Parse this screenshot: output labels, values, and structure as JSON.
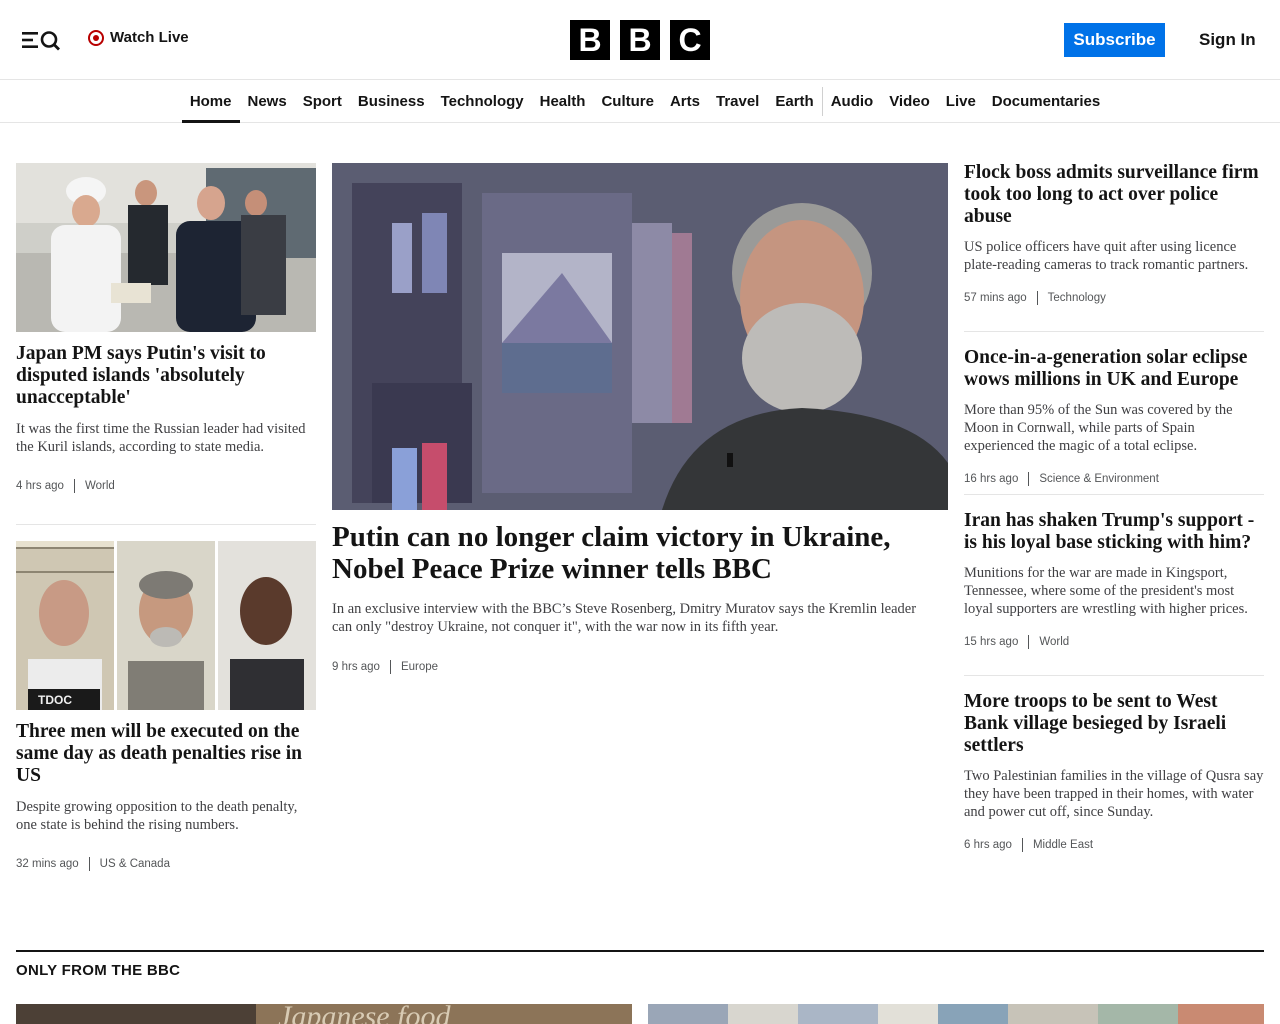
{
  "header": {
    "watch_live": "Watch Live",
    "logo_letters": [
      "B",
      "B",
      "C"
    ],
    "subscribe": "Subscribe",
    "sign_in": "Sign In"
  },
  "nav": {
    "items": [
      "Home",
      "News",
      "Sport",
      "Business",
      "Technology",
      "Health",
      "Culture",
      "Arts",
      "Travel",
      "Earth",
      "Audio",
      "Video",
      "Live",
      "Documentaries"
    ],
    "active": "Home"
  },
  "stories": {
    "left1": {
      "headline": "Japan PM says Putin's visit to disputed islands 'absolutely unacceptable'",
      "summary": "It was the first time the Russian leader had visited the Kuril islands, according to state media.",
      "time": "4 hrs ago",
      "section": "World"
    },
    "left2": {
      "headline": "Three men will be executed on the same day as death penalties rise in US",
      "summary": "Despite growing opposition to the death penalty, one state is behind the rising numbers.",
      "time": "32 mins ago",
      "section": "US & Canada",
      "mugshot_text": "TDOC"
    },
    "main": {
      "headline": "Putin can no longer claim victory in Ukraine, Nobel Peace Prize winner tells BBC",
      "summary": "In an exclusive interview with the BBC’s Steve Rosenberg, Dmitry Muratov says the Kremlin leader can only \"destroy Ukraine, not conquer it\", with the war now in its fifth year.",
      "time": "9 hrs ago",
      "section": "Europe"
    },
    "right1": {
      "headline": "Flock boss admits surveillance firm took too long to act over police abuse",
      "summary": "US police officers have quit after using licence plate-reading cameras to track romantic partners.",
      "time": "57 mins ago",
      "section": "Technology"
    },
    "right2": {
      "headline": "Once-in-a-generation solar eclipse wows millions in UK and Europe",
      "summary": "More than 95% of the Sun was covered by the Moon in Cornwall, while parts of Spain experienced the magic of a total eclipse.",
      "time": "16 hrs ago",
      "section": "Science & Environment"
    },
    "right3": {
      "headline": "Iran has shaken Trump's support - is his loyal base sticking with him?",
      "summary": "Munitions for the war are made in Kingsport, Tennessee, where some of the president's most loyal supporters are wrestling with higher prices.",
      "time": "15 hrs ago",
      "section": "World"
    },
    "right4": {
      "headline": "More troops to be sent to West Bank village besieged by Israeli settlers",
      "summary": "Two Palestinian families in the village of Qusra say they have been trapped in their homes, with water and power cut off, since Sunday.",
      "time": "6 hrs ago",
      "section": "Middle East"
    }
  },
  "only_from_bbc": {
    "title": "ONLY FROM THE BBC",
    "sign_text": "Japanese food"
  },
  "colors": {
    "accent": "#0072e8",
    "live": "#b80000",
    "text": "#141414"
  }
}
